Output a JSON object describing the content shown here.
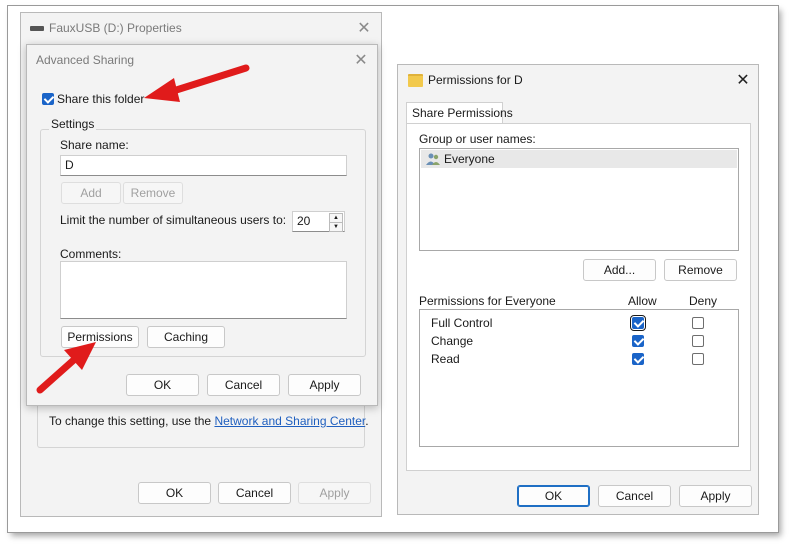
{
  "properties_window": {
    "title": "FauxUSB (D:) Properties",
    "note_prefix": "To change this setting, use the ",
    "note_link": "Network and Sharing Center",
    "note_suffix": ".",
    "ok_label": "OK",
    "cancel_label": "Cancel",
    "apply_label": "Apply"
  },
  "advanced_sharing": {
    "title": "Advanced Sharing",
    "share_checkbox_label": "Share this folder",
    "share_checked": true,
    "settings_label": "Settings",
    "share_name_label": "Share name:",
    "share_name_value": "D",
    "add_label": "Add",
    "remove_label": "Remove",
    "limit_label": "Limit the number of simultaneous users to:",
    "limit_value": "20",
    "comments_label": "Comments:",
    "comments_value": "",
    "permissions_label": "Permissions",
    "caching_label": "Caching",
    "ok_label": "OK",
    "cancel_label": "Cancel",
    "apply_label": "Apply"
  },
  "permissions_window": {
    "title": "Permissions for D",
    "tab_label": "Share Permissions",
    "group_label": "Group or user names:",
    "users": [
      {
        "name": "Everyone",
        "icon": "users-icon"
      }
    ],
    "add_label": "Add...",
    "remove_label": "Remove",
    "perm_header": "Permissions for Everyone",
    "allow_header": "Allow",
    "deny_header": "Deny",
    "permissions": [
      {
        "name": "Full Control",
        "allow": true,
        "deny": false
      },
      {
        "name": "Change",
        "allow": true,
        "deny": false
      },
      {
        "name": "Read",
        "allow": true,
        "deny": false
      }
    ],
    "ok_label": "OK",
    "cancel_label": "Cancel",
    "apply_label": "Apply"
  },
  "colors": {
    "accent": "#1a64c8",
    "arrow": "#e01b1b",
    "link": "#1f5fbf"
  }
}
